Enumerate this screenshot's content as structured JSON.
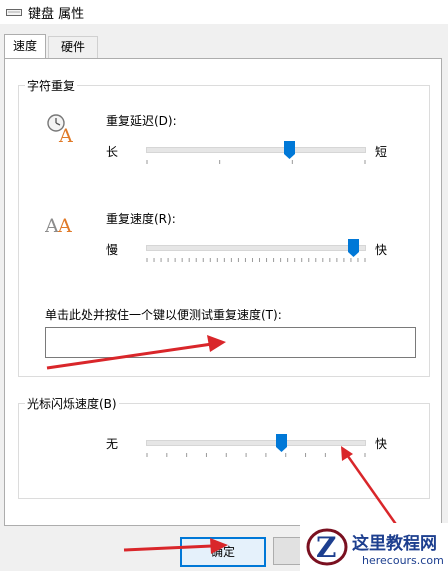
{
  "window": {
    "title": "键盘 属性"
  },
  "tabs": [
    {
      "label": "速度",
      "active": true
    },
    {
      "label": "硬件",
      "active": false
    }
  ],
  "char_repeat": {
    "legend": "字符重复",
    "delay": {
      "label": "重复延迟(D):",
      "min_label": "长",
      "max_label": "短",
      "value_fraction": 0.66
    },
    "rate": {
      "label": "重复速度(R):",
      "min_label": "慢",
      "max_label": "快",
      "value_fraction": 0.95
    },
    "test": {
      "label": "单击此处并按住一个键以便测试重复速度(T):",
      "value": ""
    }
  },
  "cursor_blink": {
    "legend": "光标闪烁速度(B)",
    "min_label": "无",
    "max_label": "快",
    "value_fraction": 0.62
  },
  "buttons": {
    "ok": "确定",
    "cancel": ""
  },
  "watermark": {
    "title": "这里教程网",
    "url": "herecours.com"
  },
  "colors": {
    "accent": "#0078d7",
    "arrow": "#d9262a",
    "watermark": "#1d3f8f"
  }
}
